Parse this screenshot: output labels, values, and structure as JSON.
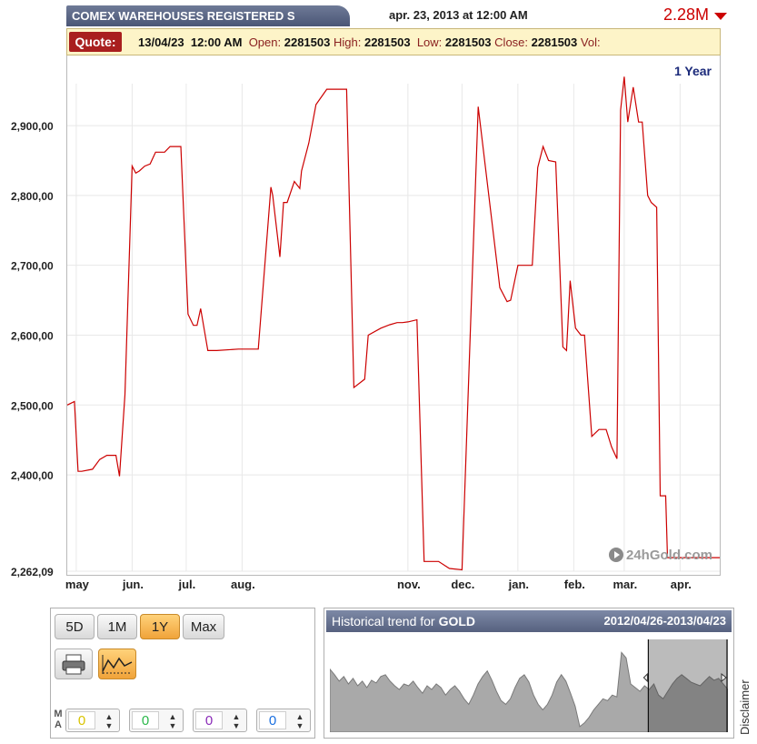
{
  "header": {
    "title": "COMEX WAREHOUSES REGISTERED S",
    "datetime": "apr. 23, 2013 at 12:00 AM",
    "price": "2.28M",
    "price_color": "#cc0000"
  },
  "quote": {
    "label": "Quote:",
    "date": "13/04/23",
    "time": "12:00 AM",
    "open_label": "Open:",
    "open": "2281503",
    "high_label": "High:",
    "high": "2281503",
    "low_label": "Low:",
    "low": "2281503",
    "close_label": "Close:",
    "close": "2281503",
    "vol_label": "Vol:"
  },
  "period_label": "1 Year",
  "logo_text": "24hGold.com",
  "controls": {
    "range_buttons": [
      "5D",
      "1M",
      "1Y",
      "Max"
    ],
    "active_range": "1Y",
    "print_icon": "printer-icon",
    "trend_icon": "trend-line-icon",
    "ma_label_top": "M",
    "ma_label_bottom": "A",
    "ma_values": [
      "0",
      "0",
      "0",
      "0"
    ],
    "ma_colors": [
      "#d9c400",
      "#2bb84a",
      "#8a2bb8",
      "#1a6fe0"
    ]
  },
  "historical": {
    "title": "Historical trend for",
    "symbol": "GOLD",
    "range": "2012/04/26-2013/04/23"
  },
  "disclaimer": "Disclaimer",
  "chart_data": {
    "type": "line",
    "title": "",
    "xlabel": "",
    "ylabel": "",
    "line_color": "#cc0000",
    "grid": true,
    "ylim": [
      2262093,
      2960000
    ],
    "y_ticks": [
      2262093,
      2400000,
      2500000,
      2600000,
      2700000,
      2800000,
      2900000
    ],
    "y_tick_labels": [
      "2,262,09",
      "2,400,00",
      "2,500,00",
      "2,600,00",
      "2,700,00",
      "2,800,00",
      "2,900,00"
    ],
    "x_ticks": [
      {
        "date": "2012-05-01",
        "label": "may"
      },
      {
        "date": "2012-06-01",
        "label": "jun."
      },
      {
        "date": "2012-07-01",
        "label": "jul."
      },
      {
        "date": "2012-08-01",
        "label": "aug."
      },
      {
        "date": "2012-11-01",
        "label": "nov."
      },
      {
        "date": "2012-12-01",
        "label": "dec."
      },
      {
        "date": "2013-01-01",
        "label": "jan."
      },
      {
        "date": "2013-02-01",
        "label": "feb."
      },
      {
        "date": "2013-03-01",
        "label": "mar."
      },
      {
        "date": "2013-04-01",
        "label": "apr."
      }
    ],
    "x_range": [
      "2012-04-26",
      "2013-04-23"
    ],
    "series": [
      {
        "x": [
          "2012-04-26",
          "2012-04-30",
          "2012-05-02",
          "2012-05-04",
          "2012-05-10",
          "2012-05-14",
          "2012-05-18",
          "2012-05-23",
          "2012-05-25",
          "2012-05-28",
          "2012-06-01",
          "2012-06-03",
          "2012-06-05",
          "2012-06-08",
          "2012-06-11",
          "2012-06-14",
          "2012-06-19",
          "2012-06-22",
          "2012-06-25",
          "2012-06-28",
          "2012-07-02",
          "2012-07-05",
          "2012-07-07",
          "2012-07-09",
          "2012-07-13",
          "2012-07-16",
          "2012-07-18",
          "2012-07-30",
          "2012-08-10",
          "2012-08-17",
          "2012-08-18",
          "2012-08-22",
          "2012-08-24",
          "2012-08-26",
          "2012-08-30",
          "2012-09-02",
          "2012-09-03",
          "2012-09-07",
          "2012-09-11",
          "2012-09-17",
          "2012-09-21",
          "2012-09-28",
          "2012-10-02",
          "2012-10-08",
          "2012-10-10",
          "2012-10-17",
          "2012-10-22",
          "2012-10-26",
          "2012-10-29",
          "2012-11-01",
          "2012-11-06",
          "2012-11-10",
          "2012-11-18",
          "2012-11-24",
          "2012-12-01",
          "2012-12-10",
          "2012-12-22",
          "2012-12-26",
          "2012-12-28",
          "2013-01-01",
          "2013-01-04",
          "2013-01-09",
          "2013-01-12",
          "2013-01-15",
          "2013-01-18",
          "2013-01-22",
          "2013-01-26",
          "2013-01-28",
          "2013-01-30",
          "2013-02-02",
          "2013-02-05",
          "2013-02-07",
          "2013-02-11",
          "2013-02-15",
          "2013-02-19",
          "2013-02-22",
          "2013-02-25",
          "2013-02-27",
          "2013-03-01",
          "2013-03-03",
          "2013-03-06",
          "2013-03-09",
          "2013-03-11",
          "2013-03-14",
          "2013-03-16",
          "2013-03-19",
          "2013-03-21",
          "2013-03-24",
          "2013-03-25",
          "2013-03-28",
          "2013-03-31",
          "2013-04-01",
          "2013-04-03",
          "2013-04-05",
          "2013-04-08",
          "2013-04-10",
          "2013-04-12",
          "2013-04-14",
          "2013-04-16",
          "2013-04-17",
          "2013-04-19",
          "2013-04-20",
          "2013-04-21",
          "2013-04-23"
        ],
        "y": [
          2500000,
          2505000,
          2405000,
          2405000,
          2408000,
          2422000,
          2428000,
          2428000,
          2398000,
          2515000,
          2842000,
          2832000,
          2835000,
          2842000,
          2845000,
          2862000,
          2862000,
          2870000,
          2870000,
          2870000,
          2630000,
          2614000,
          2614000,
          2638000,
          2578000,
          2578000,
          2578000,
          2580000,
          2580000,
          2812000,
          2800000,
          2712000,
          2790000,
          2790000,
          2820000,
          2810000,
          2835000,
          2875000,
          2930000,
          2952000,
          2952000,
          2952000,
          2525000,
          2537000,
          2600000,
          2610000,
          2615000,
          2618000,
          2618000,
          2619000,
          2622000,
          2276000,
          2276000,
          2266000,
          2264000,
          2927000,
          2668000,
          2648000,
          2650000,
          2700000,
          2700000,
          2700000,
          2840000,
          2870000,
          2850000,
          2848000,
          2583000,
          2578000,
          2678000,
          2610000,
          2600000,
          2600000,
          2455000,
          2465000,
          2465000,
          2440000,
          2423000,
          2922000,
          2970000,
          2905000,
          2955000,
          2905000,
          2905000,
          2800000,
          2790000,
          2783000,
          2370000,
          2370000,
          2281503,
          2281503,
          2281503,
          2281503,
          2281503,
          2281503,
          2281503,
          2281503,
          2281503,
          2281503,
          2281503,
          2281503,
          2281503,
          2281503,
          2281503,
          2281503
        ]
      }
    ]
  },
  "hist_data": {
    "values": [
      0.68,
      0.62,
      0.55,
      0.6,
      0.52,
      0.58,
      0.5,
      0.55,
      0.48,
      0.56,
      0.53,
      0.6,
      0.62,
      0.55,
      0.5,
      0.46,
      0.52,
      0.5,
      0.55,
      0.48,
      0.42,
      0.5,
      0.46,
      0.52,
      0.48,
      0.4,
      0.46,
      0.5,
      0.44,
      0.36,
      0.3,
      0.4,
      0.52,
      0.6,
      0.66,
      0.56,
      0.44,
      0.34,
      0.3,
      0.36,
      0.48,
      0.58,
      0.62,
      0.54,
      0.4,
      0.3,
      0.24,
      0.3,
      0.4,
      0.54,
      0.62,
      0.55,
      0.42,
      0.28,
      0.06,
      0.1,
      0.16,
      0.24,
      0.3,
      0.36,
      0.34,
      0.4,
      0.38,
      0.86,
      0.8,
      0.52,
      0.48,
      0.44,
      0.5,
      0.46,
      0.52,
      0.4,
      0.36,
      0.44,
      0.52,
      0.58,
      0.62,
      0.58,
      0.54,
      0.52,
      0.5,
      0.55,
      0.6,
      0.56,
      0.58,
      0.52,
      0.46
    ],
    "window_start_fraction": 0.8
  }
}
